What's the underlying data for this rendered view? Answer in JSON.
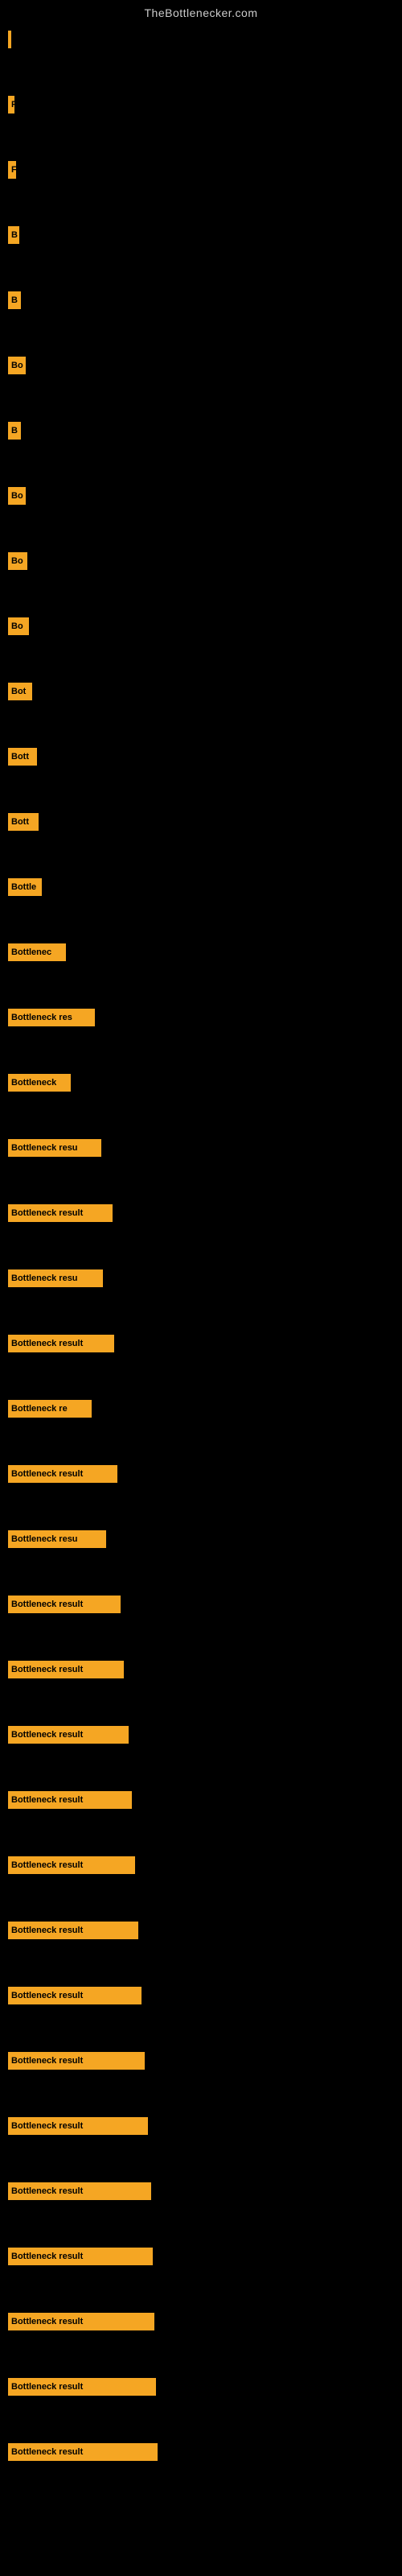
{
  "site": {
    "title": "TheBottlenecker.com"
  },
  "bars": [
    {
      "label": "",
      "width": 4,
      "text": ""
    },
    {
      "label": "F",
      "width": 8,
      "text": "F"
    },
    {
      "label": "F",
      "width": 10,
      "text": "F"
    },
    {
      "label": "B",
      "width": 14,
      "text": "B"
    },
    {
      "label": "B",
      "width": 16,
      "text": "B"
    },
    {
      "label": "Bo",
      "width": 22,
      "text": "Bo"
    },
    {
      "label": "B",
      "width": 16,
      "text": "B"
    },
    {
      "label": "Bo",
      "width": 22,
      "text": "Bo"
    },
    {
      "label": "Bo",
      "width": 24,
      "text": "Bo"
    },
    {
      "label": "Bo",
      "width": 26,
      "text": "Bo"
    },
    {
      "label": "Bot",
      "width": 30,
      "text": "Bot"
    },
    {
      "label": "Bott",
      "width": 36,
      "text": "Bott"
    },
    {
      "label": "Bott",
      "width": 38,
      "text": "Bott"
    },
    {
      "label": "Bottl",
      "width": 42,
      "text": "Bottle"
    },
    {
      "label": "Bottlenec",
      "width": 72,
      "text": "Bottlenec"
    },
    {
      "label": "Bottleneck res",
      "width": 108,
      "text": "Bottleneck res"
    },
    {
      "label": "Bottleneck",
      "width": 78,
      "text": "Bottleneck"
    },
    {
      "label": "Bottleneck resu",
      "width": 116,
      "text": "Bottleneck resu"
    },
    {
      "label": "Bottleneck result",
      "width": 130,
      "text": "Bottleneck result"
    },
    {
      "label": "Bottleneck resu",
      "width": 118,
      "text": "Bottleneck resu"
    },
    {
      "label": "Bottleneck result",
      "width": 132,
      "text": "Bottleneck result"
    },
    {
      "label": "Bottleneck re",
      "width": 104,
      "text": "Bottleneck re"
    },
    {
      "label": "Bottleneck result",
      "width": 136,
      "text": "Bottleneck result"
    },
    {
      "label": "Bottleneck resu",
      "width": 122,
      "text": "Bottleneck resu"
    },
    {
      "label": "Bottleneck result",
      "width": 140,
      "text": "Bottleneck result"
    },
    {
      "label": "Bottleneck result",
      "width": 144,
      "text": "Bottleneck result"
    },
    {
      "label": "Bottleneck result",
      "width": 150,
      "text": "Bottleneck result"
    },
    {
      "label": "Bottleneck result",
      "width": 154,
      "text": "Bottleneck result"
    },
    {
      "label": "Bottleneck result",
      "width": 158,
      "text": "Bottleneck result"
    },
    {
      "label": "Bottleneck result",
      "width": 162,
      "text": "Bottleneck result"
    },
    {
      "label": "Bottleneck result",
      "width": 166,
      "text": "Bottleneck result"
    },
    {
      "label": "Bottleneck result",
      "width": 170,
      "text": "Bottleneck result"
    },
    {
      "label": "Bottleneck result",
      "width": 174,
      "text": "Bottleneck result"
    },
    {
      "label": "Bottleneck result",
      "width": 178,
      "text": "Bottleneck result"
    },
    {
      "label": "Bottleneck result",
      "width": 180,
      "text": "Bottleneck result"
    },
    {
      "label": "Bottleneck result",
      "width": 182,
      "text": "Bottleneck result"
    },
    {
      "label": "Bottleneck result",
      "width": 184,
      "text": "Bottleneck result"
    },
    {
      "label": "Bottleneck result",
      "width": 186,
      "text": "Bottleneck result"
    }
  ]
}
